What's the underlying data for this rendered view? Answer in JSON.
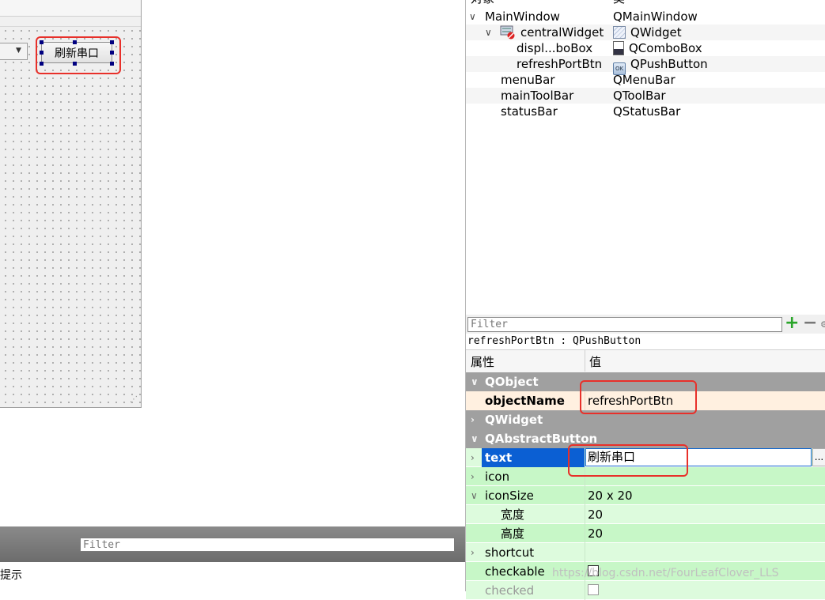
{
  "designer": {
    "refresh_button_text": "刷新串口",
    "bottom_filter_placeholder": "Filter",
    "bottom_text": "提示"
  },
  "object_inspector": {
    "col_object": "对象",
    "col_class": "类",
    "rows": [
      {
        "name": "MainWindow",
        "class": "QMainWindow"
      },
      {
        "name": "centralWidget",
        "class": "QWidget"
      },
      {
        "name": "displ...boBox",
        "class": "QComboBox"
      },
      {
        "name": "refreshPortBtn",
        "class": "QPushButton"
      },
      {
        "name": "menuBar",
        "class": "QMenuBar"
      },
      {
        "name": "mainToolBar",
        "class": "QToolBar"
      },
      {
        "name": "statusBar",
        "class": "QStatusBar"
      }
    ],
    "push_icon_text": "OK"
  },
  "property_editor": {
    "filter_placeholder": "Filter",
    "class_line": "refreshPortBtn : QPushButton",
    "col_property": "属性",
    "col_value": "值",
    "groups": {
      "qobject": "QObject",
      "qwidget": "QWidget",
      "qabstractbutton": "QAbstractButton"
    },
    "props": {
      "objectName": {
        "name": "objectName",
        "value": "refreshPortBtn"
      },
      "text": {
        "name": "text",
        "value": "刷新串口"
      },
      "icon": {
        "name": "icon",
        "value": ""
      },
      "iconSize": {
        "name": "iconSize",
        "value": "20 x 20"
      },
      "width": {
        "name": "宽度",
        "value": "20"
      },
      "height": {
        "name": "高度",
        "value": "20"
      },
      "shortcut": {
        "name": "shortcut",
        "value": ""
      },
      "checkable": {
        "name": "checkable",
        "value": false
      },
      "checked": {
        "name": "checked",
        "value": false
      }
    },
    "dots_label": "..."
  },
  "watermark": "https://blog.csdn.net/FourLeafClover_LLS",
  "colors": {
    "group_header": "#a0a0a0",
    "selected_row": "#0b5fd3",
    "green_row": "#ddfbdd",
    "cream_row": "#fff0e0",
    "highlight_box": "#e8302a"
  }
}
